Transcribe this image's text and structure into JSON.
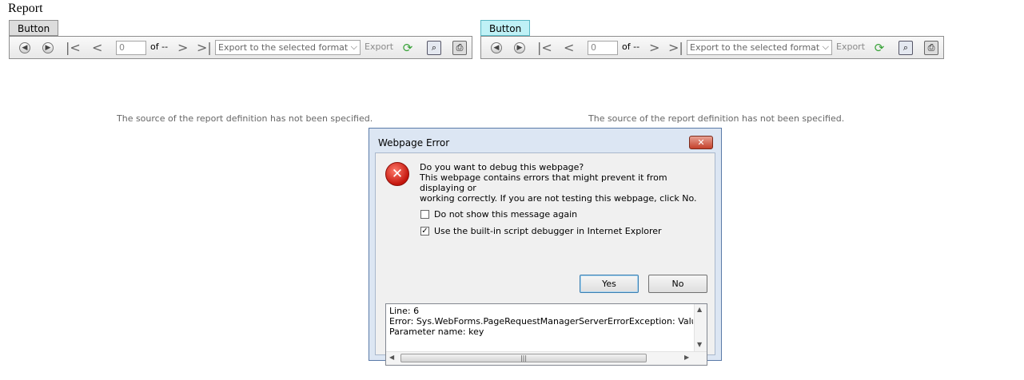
{
  "page": {
    "title": "Report"
  },
  "viewers": [
    {
      "button_label": "Button",
      "page_value": "0",
      "of_label": "of --",
      "format_select": "Export to the selected format",
      "export_label": "Export",
      "source_message": "The source of the report definition has not been specified."
    },
    {
      "button_label": "Button",
      "page_value": "0",
      "of_label": "of --",
      "format_select": "Export to the selected format",
      "export_label": "Export",
      "source_message": "The source of the report definition has not been specified."
    }
  ],
  "icons": {
    "back": "back-icon",
    "forward": "forward-icon",
    "first": "first-page-icon",
    "prev": "previous-page-icon",
    "next": "next-page-icon",
    "last": "last-page-icon",
    "refresh": "refresh-icon",
    "find": "find-icon",
    "print": "print-icon"
  },
  "dialog": {
    "title": "Webpage Error",
    "close_symbol": "✕",
    "question": "Do you want to debug this webpage?",
    "body_line1": "This webpage contains errors that might prevent it from displaying or",
    "body_line2": "working correctly. If you are not testing this webpage, click No.",
    "checkbox1": {
      "label": "Do not show this message again",
      "checked": false
    },
    "checkbox2": {
      "label": "Use the built-in script debugger in Internet Explorer",
      "checked": true
    },
    "yes_label": "Yes",
    "no_label": "No",
    "details_line1": "Line: 6",
    "details_line2": "Error: Sys.WebForms.PageRequestManagerServerErrorException: Value cannot be null.",
    "details_line3": "Parameter name: key"
  },
  "colors": {
    "active_button": "#bff1f6",
    "error_red": "#c3150c",
    "refresh_green": "#3aa33a"
  }
}
